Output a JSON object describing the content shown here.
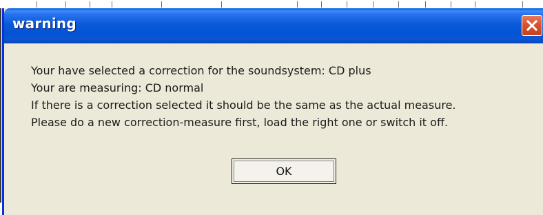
{
  "dialog": {
    "title": "warning",
    "message_lines": [
      "Your have selected a correction for the soundsystem: CD plus",
      "Your are measuring: CD normal",
      "If there is a correction selected it should be the same as the actual measure.",
      "Please do a new correction-measure first, load the right one or switch it off."
    ],
    "ok_label": "OK",
    "close_icon": "close-icon"
  },
  "colors": {
    "titlebar": "#0a5ad9",
    "dialog_body": "#ece9d8",
    "close_button": "#d8542e"
  }
}
